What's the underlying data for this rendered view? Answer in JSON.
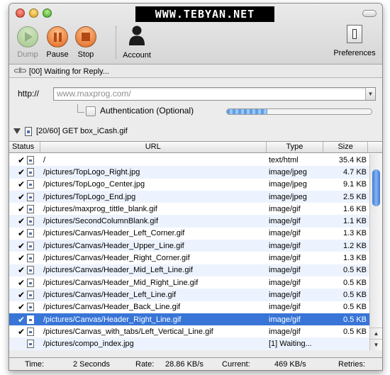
{
  "window": {
    "banner": "WWW.TEBYAN.NET"
  },
  "toolbar": {
    "dump_label": "Dump",
    "pause_label": "Pause",
    "stop_label": "Stop",
    "account_label": "Account",
    "preferences_label": "Preferences"
  },
  "status": {
    "text": "[00] Waiting for Reply..."
  },
  "url": {
    "scheme": "http://",
    "placeholder": "www.maxprog.com/"
  },
  "auth": {
    "label": "Authentication (Optional)",
    "checked": false,
    "progress": 0.28
  },
  "request": {
    "text": "[20/60]  GET box_iCash.gif"
  },
  "table": {
    "headers": {
      "status": "Status",
      "url": "URL",
      "type": "Type",
      "size": "Size"
    },
    "rows": [
      {
        "check": "✔",
        "url": "/",
        "type": "text/html",
        "size": "35.4 KB"
      },
      {
        "check": "✔",
        "url": "/pictures/TopLogo_Right.jpg",
        "type": "image/jpeg",
        "size": "4.7 KB"
      },
      {
        "check": "✔",
        "url": "/pictures/TopLogo_Center.jpg",
        "type": "image/jpeg",
        "size": "9.1 KB"
      },
      {
        "check": "✔",
        "url": "/pictures/TopLogo_End.jpg",
        "type": "image/jpeg",
        "size": "2.5 KB"
      },
      {
        "check": "✔",
        "url": "/pictures/maxprog_tittle_blank.gif",
        "type": "image/gif",
        "size": "1.6 KB"
      },
      {
        "check": "✔",
        "url": "/pictures/SecondColumnBlank.gif",
        "type": "image/gif",
        "size": "1.1 KB"
      },
      {
        "check": "✔",
        "url": "/pictures/Canvas/Header_Left_Corner.gif",
        "type": "image/gif",
        "size": "1.3 KB"
      },
      {
        "check": "✔",
        "url": "/pictures/Canvas/Header_Upper_Line.gif",
        "type": "image/gif",
        "size": "1.2 KB"
      },
      {
        "check": "✔",
        "url": "/pictures/Canvas/Header_Right_Corner.gif",
        "type": "image/gif",
        "size": "1.3 KB"
      },
      {
        "check": "✔",
        "url": "/pictures/Canvas/Header_Mid_Left_Line.gif",
        "type": "image/gif",
        "size": "0.5 KB"
      },
      {
        "check": "✔",
        "url": "/pictures/Canvas/Header_Mid_Right_Line.gif",
        "type": "image/gif",
        "size": "0.5 KB"
      },
      {
        "check": "✔",
        "url": "/pictures/Canvas/Header_Left_Line.gif",
        "type": "image/gif",
        "size": "0.5 KB"
      },
      {
        "check": "✔",
        "url": "/pictures/Canvas/Header_Back_Line.gif",
        "type": "image/gif",
        "size": "0.5 KB"
      },
      {
        "check": "✔",
        "url": "/pictures/Canvas/Header_Right_Line.gif",
        "type": "image/gif",
        "size": "0.5 KB",
        "selected": true
      },
      {
        "check": "✔",
        "url": "/pictures/Canvas_with_tabs/Left_Vertical_Line.gif",
        "type": "image/gif",
        "size": "0.5 KB"
      },
      {
        "check": "",
        "url": "/pictures/compo_index.jpg",
        "type": "[1] Waiting...",
        "size": ""
      }
    ]
  },
  "footer": {
    "time_label": "Time:",
    "time_value": "2 Seconds",
    "rate_label": "Rate:",
    "rate_value": "28.86  KB/s",
    "current_label": "Current:",
    "current_value": "469  KB/s",
    "retries_label": "Retries:"
  },
  "colors": {
    "selection": "#3875d7",
    "stripe": "#edf3fe",
    "orange_button": "#e0651c"
  }
}
